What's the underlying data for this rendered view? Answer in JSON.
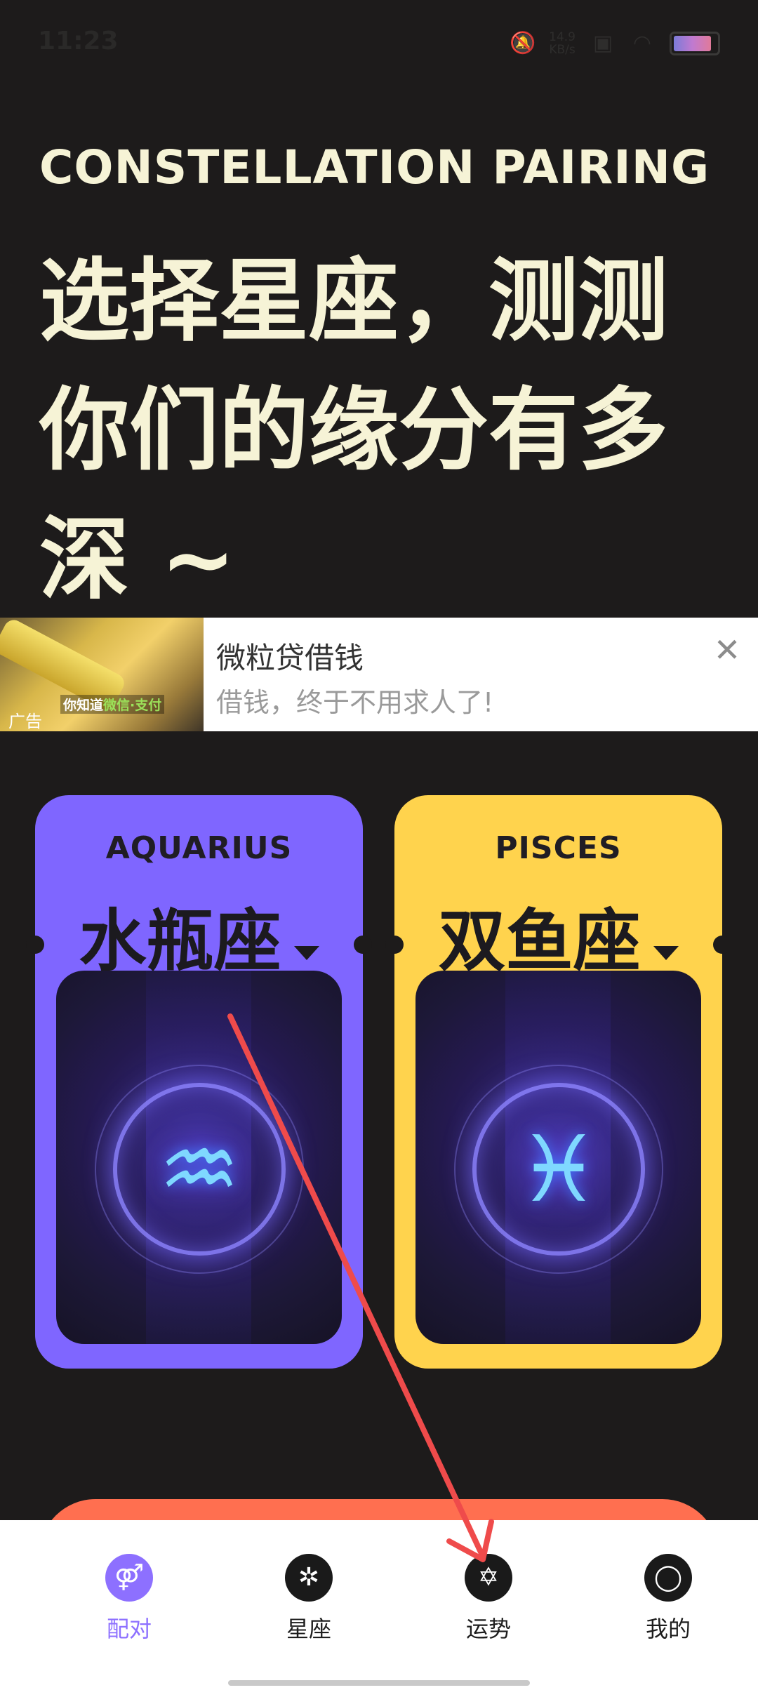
{
  "status_bar": {
    "time": "11:23",
    "net_speed_value": "14.9",
    "net_speed_unit": "KB/s",
    "battery_level": 0.9
  },
  "hero": {
    "subtitle_en": "CONSTELLATION PAIRING",
    "headline": "选择星座，测测你们的缘分有多深 ~"
  },
  "ad": {
    "title": "微粒贷借钱",
    "description": "借钱，终于不用求人了!",
    "tag": "广告",
    "thumb_caption_prefix": "你知道",
    "thumb_caption_highlight": "微信·支付",
    "close_icon": "close-icon"
  },
  "cards": [
    {
      "en": "AQUARIUS",
      "zh": "水瓶座",
      "color": "#7f66ff",
      "glyph": "♒"
    },
    {
      "en": "PISCES",
      "zh": "双鱼座",
      "color": "#ffd34d",
      "glyph": "♓"
    }
  ],
  "tabs": [
    {
      "label": "配对",
      "icon": "couple-icon",
      "glyph": "⚤",
      "active": true
    },
    {
      "label": "星座",
      "icon": "constellation-icon",
      "glyph": "✲",
      "active": false
    },
    {
      "label": "运势",
      "icon": "fortune-star-icon",
      "glyph": "✡",
      "active": false
    },
    {
      "label": "我的",
      "icon": "profile-icon",
      "glyph": "◯",
      "active": false
    }
  ],
  "colors": {
    "background": "#1d1b1b",
    "headline": "#f6f3d6",
    "accent_purple": "#8d70ff",
    "cta": "#ff6f50",
    "annotation_arrow": "#ef4b4b"
  }
}
